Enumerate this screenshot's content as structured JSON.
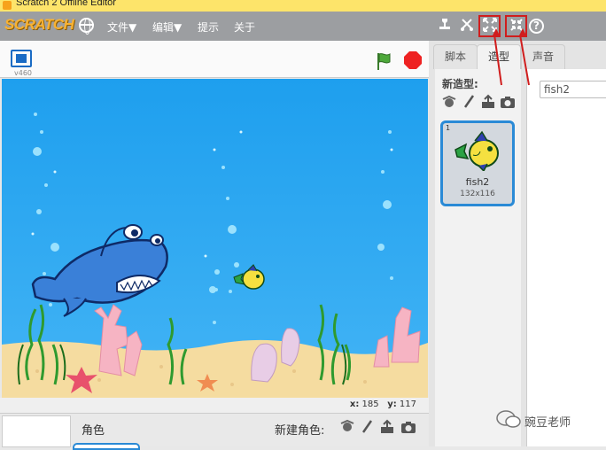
{
  "window": {
    "title": "Scratch 2 Offline Editor"
  },
  "menubar": {
    "logo": "SCRATCH",
    "menus": [
      "文件▼",
      "编辑▼",
      "提示",
      "关于"
    ]
  },
  "stage": {
    "version": "v460"
  },
  "coords": {
    "x_label": "x:",
    "x": "185",
    "y_label": "y:",
    "y": "117"
  },
  "sprites": {
    "label": "角色",
    "new_sprite_label": "新建角色:"
  },
  "tabs": [
    "脚本",
    "造型",
    "声音"
  ],
  "costumes": {
    "new_costume_label": "新造型:",
    "items": [
      {
        "number": "1",
        "name": "fish2",
        "size": "132x116"
      }
    ],
    "selected_name": "fish2"
  },
  "watermark": {
    "text": "豌豆老师"
  },
  "colors": {
    "menubar": "#9c9ea1",
    "water": "#2ea6f0",
    "sand": "#f5dca0",
    "highlight": "#d01d1d",
    "selection": "#2a8ad6"
  }
}
